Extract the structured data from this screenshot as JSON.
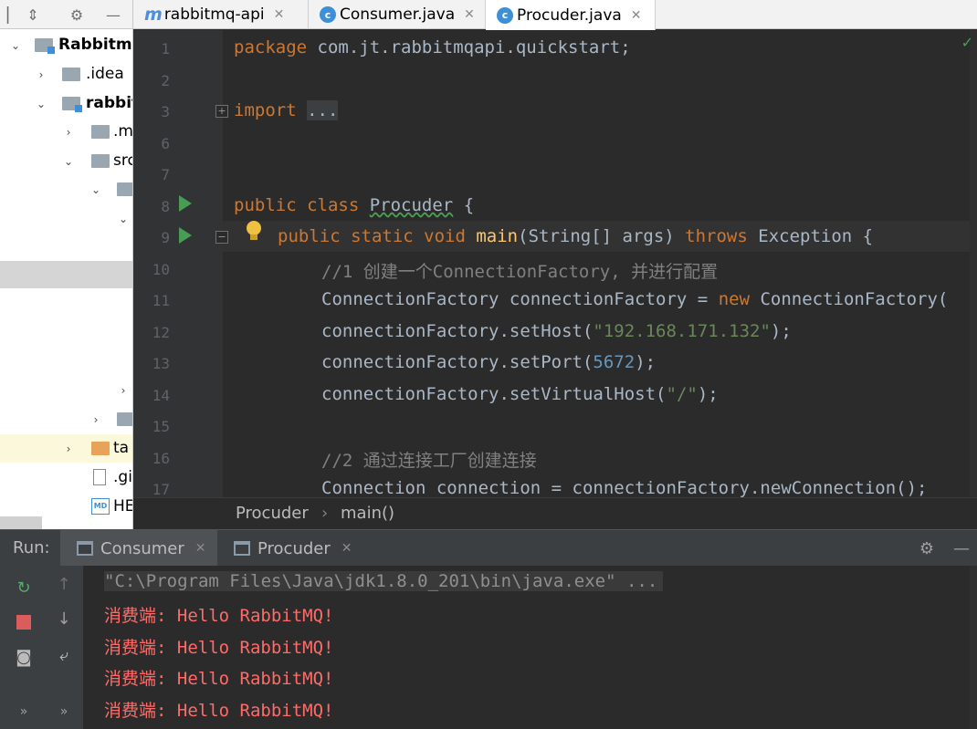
{
  "project": {
    "items": [
      {
        "label": "Rabbitmq",
        "depth": 0,
        "expanded": true,
        "icon": "module-folder-icon"
      },
      {
        "label": ".idea",
        "depth": 1,
        "expanded": false,
        "icon": "folder-icon"
      },
      {
        "label": "rabbit",
        "depth": 1,
        "expanded": true,
        "icon": "module-folder-icon"
      },
      {
        "label": ".m",
        "depth": 2,
        "expanded": false,
        "icon": "folder-icon"
      },
      {
        "label": "src",
        "depth": 2,
        "expanded": true,
        "icon": "folder-icon"
      },
      {
        "label": "",
        "depth": 3,
        "expanded": true,
        "icon": "folder-icon"
      },
      {
        "label": "",
        "depth": 4,
        "expanded": true,
        "icon": ""
      },
      {
        "label": "",
        "depth": 4,
        "expanded": false,
        "icon": ""
      },
      {
        "label": "",
        "depth": 3,
        "expanded": false,
        "icon": "folder-icon"
      },
      {
        "label": "ta",
        "depth": 2,
        "expanded": false,
        "icon": "folder-orange-icon"
      },
      {
        "label": ".gi",
        "depth": 2,
        "expanded": null,
        "icon": "file-icon"
      },
      {
        "label": "HE",
        "depth": 2,
        "expanded": null,
        "icon": "markdown-file-icon"
      }
    ]
  },
  "tabs": [
    {
      "label": "rabbitmq-api",
      "icon": "maven-m-icon"
    },
    {
      "label": "Consumer.java",
      "icon": "java-class-icon"
    },
    {
      "label": "Procuder.java",
      "icon": "java-class-icon"
    }
  ],
  "editor": {
    "line_numbers": [
      "1",
      "2",
      "3",
      "6",
      "7",
      "8",
      "9",
      "10",
      "11",
      "12",
      "13",
      "14",
      "15",
      "16",
      "17"
    ],
    "lines": {
      "l1_kw": "package",
      "l1_rest": " com.jt.rabbitmqapi.quickstart;",
      "l3_kw": "import",
      "l3_dots": "...",
      "l8_kw": "public class",
      "l8_name": "Procuder",
      "l8_rest": " {",
      "l9_kw": "public static void",
      "l9_fn": "main",
      "l9_args": "(String[] args)",
      "l9_throws": "throws",
      "l9_rest": " Exception {",
      "l10_cmt": "//1 创建一个ConnectionFactory, 并进行配置",
      "l11_a": "ConnectionFactory connectionFactory = ",
      "l11_new": "new",
      "l11_b": " ConnectionFactory(",
      "l12_a": "connectionFactory.setHost(",
      "l12_str": "\"192.168.171.132\"",
      "l12_b": ");",
      "l13_a": "connectionFactory.setPort(",
      "l13_num": "5672",
      "l13_b": ");",
      "l14_a": "connectionFactory.setVirtualHost(",
      "l14_str": "\"/\"",
      "l14_b": ");",
      "l16_cmt": "//2 通过连接工厂创建连接",
      "l17": "Connection connection = connectionFactory.newConnection();"
    }
  },
  "breadcrumb": {
    "class_name": "Procuder",
    "separator": "›",
    "method": "main()"
  },
  "run": {
    "label": "Run:",
    "tabs": [
      {
        "label": "Consumer"
      },
      {
        "label": "Procuder"
      }
    ],
    "console": [
      "\"C:\\Program Files\\Java\\jdk1.8.0_201\\bin\\java.exe\" ...",
      "消费端: Hello RabbitMQ!",
      "消费端: Hello RabbitMQ!",
      "消费端: Hello RabbitMQ!",
      "消费端: Hello RabbitMQ!"
    ]
  },
  "colors": {
    "editor_bg": "#2b2b2b",
    "keyword": "#cc7832",
    "string": "#6a8759",
    "number": "#6897bb",
    "comment": "#808080",
    "console_output": "#ff6b68",
    "run_gutter": "#499c54"
  }
}
